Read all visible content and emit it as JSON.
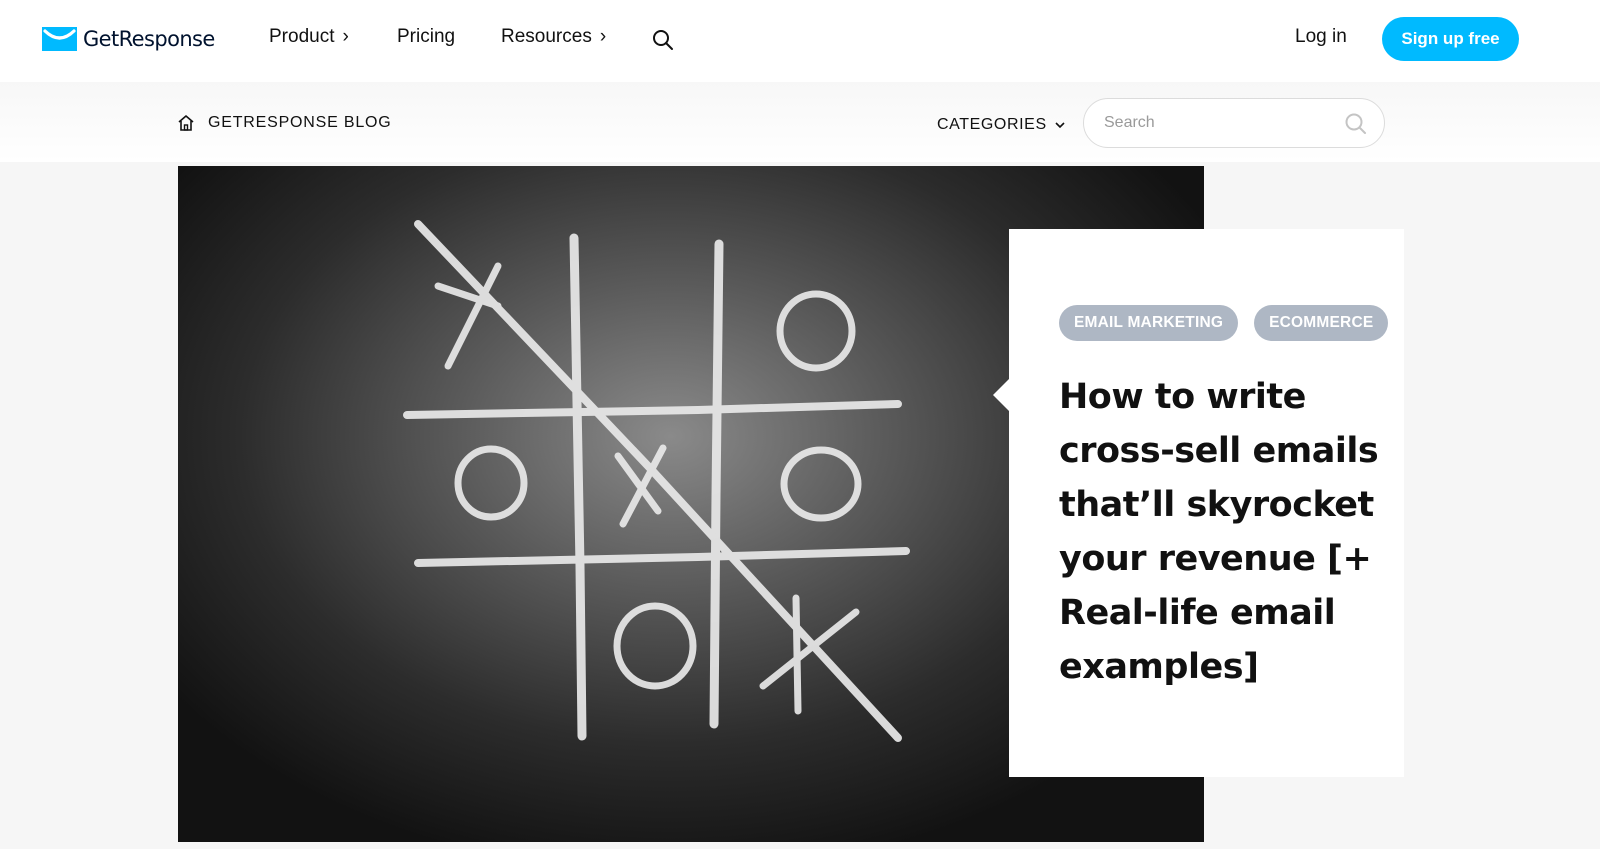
{
  "brand": {
    "name": "GetResponse",
    "accent_color": "#00baff",
    "logo_icon": "envelope-smile-icon"
  },
  "nav": {
    "items": [
      {
        "label": "Product",
        "has_submenu": true
      },
      {
        "label": "Pricing",
        "has_submenu": false
      },
      {
        "label": "Resources",
        "has_submenu": true
      }
    ],
    "submenu_glyph": "›",
    "search_icon": "search-icon",
    "login_label": "Log in",
    "signup_label": "Sign up free"
  },
  "blog_header": {
    "home_icon": "home-icon",
    "breadcrumb": "GETRESPONSE BLOG",
    "categories_label": "CATEGORIES",
    "search_placeholder": "Search",
    "search_value": ""
  },
  "featured_post": {
    "tags": [
      "EMAIL MARKETING",
      "ECOMMERCE"
    ],
    "tag_color": "#aeb7c4",
    "title": "How to write cross-sell emails that’ll skyrocket your revenue [+ Real-life email examples]",
    "image": "chalkboard-tic-tac-toe-image"
  }
}
